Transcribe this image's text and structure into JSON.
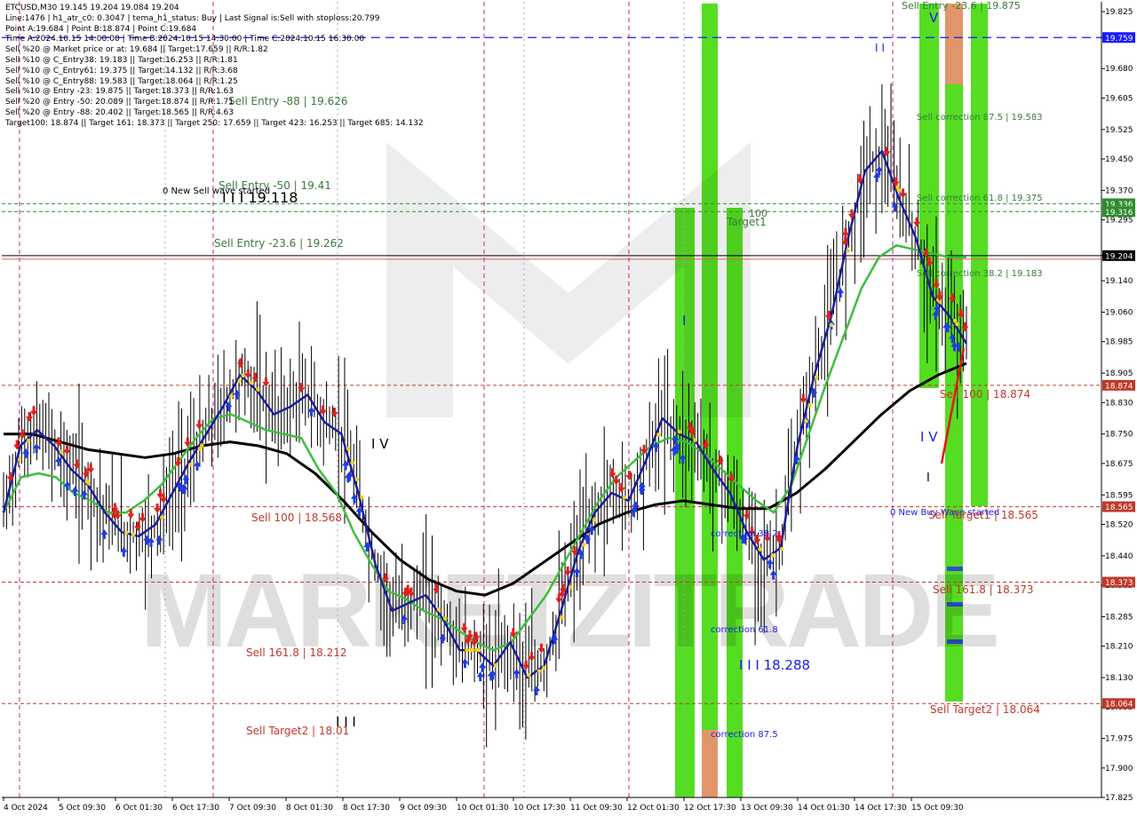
{
  "header": {
    "symbol_line": "ETCUSD,M30  19.145 19.204 19.084 19.204",
    "info_lines": [
      "Line:1476 | h1_atr_c0: 0.3047 | tema_h1_status: Buy | Last Signal is:Sell with stoploss:20.799",
      "Point A:19.684 | Point B:18.874 | Point C:19.684",
      "Time A:2024.10.15 14:00:00 | Time B:2024.10.15 14:30:00 | Time C:2024.10.15 16:30:00",
      "Sell %20 @ Market price or at: 19.684 || Target:17.659 || R/R:1.82",
      "Sell %10 @ C_Entry38: 19.183 || Target:16.253 || R/R:1.81",
      "Sell %10 @ C_Entry61: 19.375 || Target:14.132 || R/R:3.68",
      "Sell %10 @ C_Entry88: 19.583 || Target:18.064 || R/R:1.25",
      "Sell %10 @ Entry -23: 19.875 || Target:18.373 || R/R:1.63",
      "Sell %20 @ Entry -50: 20.089 || Target:18.874 || R/R:1.71",
      "Sell %20 @ Entry -88: 20.402 || Target:18.565 || R/R:4.63",
      "Target100: 18.874 || Target 161: 18.373 || Target 250: 17.659 || Target 423: 16.253 || Target 685: 14.132"
    ]
  },
  "watermark": "MARKETZITRADE",
  "levels": [
    {
      "value": 19.759,
      "label": "19.759",
      "color": "#1a1aff"
    },
    {
      "value": 19.336,
      "label": "19.336",
      "color": "#2e8b2e"
    },
    {
      "value": 19.316,
      "label": "19.316",
      "color": "#2e8b2e"
    },
    {
      "value": 19.204,
      "label": "19.204",
      "color": "#000000"
    },
    {
      "value": 18.874,
      "label": "18.874",
      "color": "#c0392b"
    },
    {
      "value": 18.565,
      "label": "18.565",
      "color": "#c0392b"
    },
    {
      "value": 18.373,
      "label": "18.373",
      "color": "#c0392b"
    },
    {
      "value": 18.064,
      "label": "18.064",
      "color": "#c0392b"
    }
  ],
  "annotations": [
    {
      "text": "Sell Entry -23.6 | 19.875",
      "color": "#3a7a3a"
    },
    {
      "text": "Sell Entry -88 | 19.626",
      "color": "#3a7a3a"
    },
    {
      "text": "Sell correction 87.5 | 19.583",
      "color": "#3a7a3a"
    },
    {
      "text": "Sell Entry -50 | 19.41",
      "color": "#3a7a3a"
    },
    {
      "text": "0 New Sell wave started",
      "color": "#000000"
    },
    {
      "text": "I I I 19.118",
      "color": "#000000"
    },
    {
      "text": "Sell correction 61.8 | 19.375",
      "color": "#3a7a3a"
    },
    {
      "text": "Target1",
      "color": "#3a7a3a"
    },
    {
      "text": "100",
      "color": "#3a7a3a"
    },
    {
      "text": "Sell Entry -23.6 | 19.262",
      "color": "#3a7a3a"
    },
    {
      "text": "Sell correction 38.2 | 19.183",
      "color": "#3a7a3a"
    },
    {
      "text": "Sell 100 | 18.874",
      "color": "#c0392b"
    },
    {
      "text": "I V",
      "color": "#000000"
    },
    {
      "text": "I V",
      "color": "#1a1aff"
    },
    {
      "text": "V",
      "color": "#1a1aff"
    },
    {
      "text": "I",
      "color": "#000000"
    },
    {
      "text": "I",
      "color": "#1a1aff"
    },
    {
      "text": "Sell 100 | 18.568",
      "color": "#c0392b"
    },
    {
      "text": "0 New Buy Wave started",
      "color": "#1a1aff"
    },
    {
      "text": "Sell Target1 | 18.565",
      "color": "#c0392b"
    },
    {
      "text": "correction 38.2",
      "color": "#1a1aff"
    },
    {
      "text": "Sell 161.8 | 18.373",
      "color": "#c0392b"
    },
    {
      "text": "correction 61.8",
      "color": "#1a1aff"
    },
    {
      "text": "Sell 161.8 | 18.212",
      "color": "#c0392b"
    },
    {
      "text": "I I I 18.288",
      "color": "#1a1aff"
    },
    {
      "text": "Sell Target2 | 18.064",
      "color": "#c0392b"
    },
    {
      "text": "Sell Target2 | 18.01",
      "color": "#c0392b"
    },
    {
      "text": "I I I",
      "color": "#000000"
    },
    {
      "text": "correction 87.5",
      "color": "#1a1aff"
    },
    {
      "text": "I I",
      "color": "#1a1aff"
    }
  ],
  "chart_data": {
    "type": "line",
    "title": "ETCUSD,M30",
    "xlabel": "",
    "ylabel": "",
    "ylim": [
      17.825,
      19.85
    ],
    "grid": false,
    "y_ticks": [
      "19.825",
      "19.759",
      "19.680",
      "19.605",
      "19.525",
      "19.450",
      "19.370",
      "19.295",
      "19.204",
      "19.140",
      "19.060",
      "18.985",
      "18.905",
      "18.830",
      "18.750",
      "18.675",
      "18.595",
      "18.520",
      "18.440",
      "18.365",
      "18.285",
      "18.210",
      "18.130",
      "18.055",
      "17.975",
      "17.900",
      "17.825"
    ],
    "x_ticks": [
      "4 Oct 2024",
      "5 Oct 09:30",
      "6 Oct 01:30",
      "6 Oct 17:30",
      "7 Oct 09:30",
      "8 Oct 01:30",
      "8 Oct 17:30",
      "9 Oct 09:30",
      "10 Oct 01:30",
      "10 Oct 17:30",
      "11 Oct 09:30",
      "12 Oct 01:30",
      "12 Oct 17:30",
      "13 Oct 09:30",
      "14 Oct 01:30",
      "14 Oct 17:30",
      "15 Oct 09:30"
    ],
    "series": [
      {
        "values": [
          18.55,
          18.72,
          18.76,
          18.72,
          18.66,
          18.62,
          18.55,
          18.5,
          18.49,
          18.52,
          18.6,
          18.68,
          18.75,
          18.82,
          18.9,
          18.86,
          18.8,
          18.82,
          18.85,
          18.78,
          18.75,
          18.6,
          18.42,
          18.3,
          18.32,
          18.34,
          18.28,
          18.2,
          18.2,
          18.16,
          18.22,
          18.13,
          18.16,
          18.3,
          18.45,
          18.55,
          18.6,
          18.58,
          18.68,
          18.79,
          18.75,
          18.73,
          18.66,
          18.6,
          18.5,
          18.43,
          18.46,
          18.72,
          18.9,
          19.05,
          19.25,
          19.42,
          19.47,
          19.35,
          19.25,
          19.1,
          19.05,
          18.98
        ]
      },
      {
        "values": [
          18.55,
          18.64,
          18.65,
          18.64,
          18.6,
          18.58,
          18.55,
          18.55,
          18.58,
          18.62,
          18.68,
          18.74,
          18.79,
          18.8,
          18.78,
          18.76,
          18.75,
          18.74,
          18.66,
          18.6,
          18.5,
          18.42,
          18.35,
          18.33,
          18.3,
          18.28,
          18.25,
          18.22,
          18.2,
          18.22,
          18.28,
          18.34,
          18.42,
          18.5,
          18.58,
          18.64,
          18.68,
          18.72,
          18.74,
          18.73,
          18.7,
          18.66,
          18.62,
          18.58,
          18.55,
          18.62,
          18.75,
          18.88,
          19.0,
          19.12,
          19.2,
          19.23,
          19.22,
          19.21,
          19.2,
          19.2
        ]
      },
      {
        "values": [
          18.75,
          18.75,
          18.73,
          18.71,
          18.7,
          18.69,
          18.7,
          18.72,
          18.73,
          18.72,
          18.7,
          18.65,
          18.58,
          18.5,
          18.43,
          18.38,
          18.35,
          18.34,
          18.37,
          18.42,
          18.47,
          18.52,
          18.55,
          18.57,
          18.58,
          18.57,
          18.56,
          18.56,
          18.6,
          18.66,
          18.73,
          18.8,
          18.86,
          18.9,
          18.93
        ]
      }
    ]
  }
}
